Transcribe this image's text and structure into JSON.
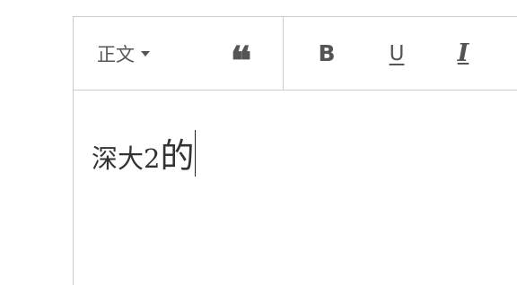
{
  "toolbar": {
    "paragraph_format": "正文",
    "blockquote_glyph": "❝",
    "bold_label": "B",
    "underline_label": "U",
    "italic_label": "I"
  },
  "content": {
    "text_small": "深大2",
    "text_large": "的"
  },
  "colors": {
    "border": "#cccccc",
    "toolbar_icon": "#555555",
    "text": "#333333"
  }
}
